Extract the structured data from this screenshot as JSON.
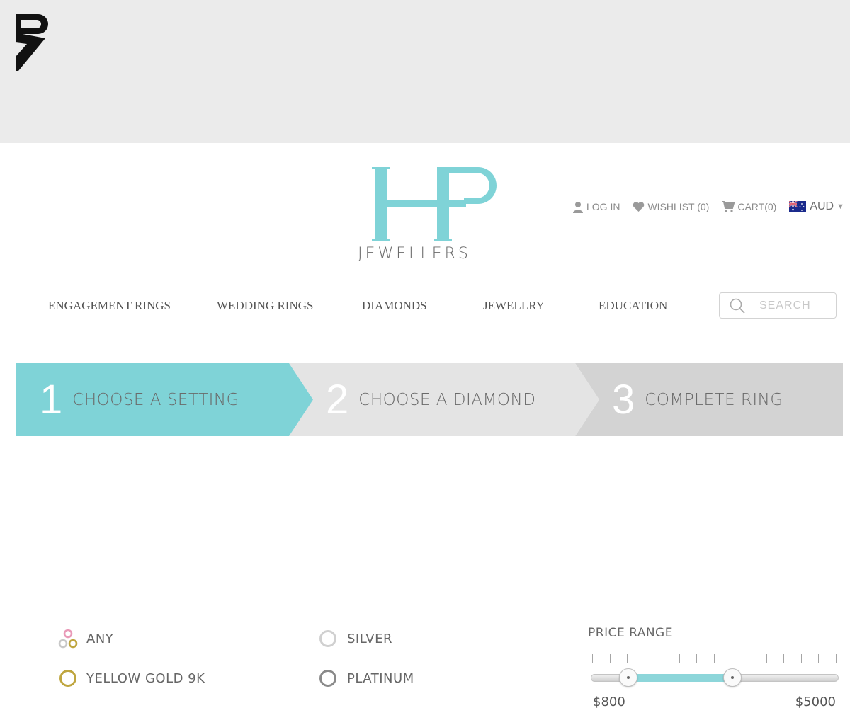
{
  "header": {
    "logo_word": "JEWELLERS",
    "user_links": [
      {
        "label": "LOG IN",
        "icon": "user-icon"
      },
      {
        "label": "WISHLIST (0)",
        "icon": "heart-icon"
      },
      {
        "label": "CART(0)",
        "icon": "cart-icon"
      }
    ],
    "currency": "AUD"
  },
  "nav": {
    "items": [
      "ENGAGEMENT RINGS",
      "WEDDING RINGS",
      "DIAMONDS",
      "JEWELLRY",
      "EDUCATION"
    ],
    "search_placeholder": "SEARCH"
  },
  "steps": [
    {
      "number": "1",
      "label": "CHOOSE A SETTING",
      "active": true
    },
    {
      "number": "2",
      "label": "CHOOSE A DIAMOND",
      "active": false
    },
    {
      "number": "3",
      "label": "COMPLETE RING",
      "active": false
    }
  ],
  "metals": [
    {
      "label": "ANY",
      "icon": "multi-metal-icon"
    },
    {
      "label": "SILVER",
      "icon": "silver-ring-icon",
      "color": "#d0d0d0"
    },
    {
      "label": "YELLOW GOLD 9K",
      "icon": "yellow-gold-ring-icon",
      "color": "#bfa640"
    },
    {
      "label": "PLATINUM",
      "icon": "platinum-ring-icon",
      "color": "#8a8a8a"
    }
  ],
  "price_range": {
    "title": "PRICE RANGE",
    "min_label": "$800",
    "max_label": "$5000",
    "selected_low": 0.15,
    "selected_high": 0.57
  },
  "colors": {
    "accent": "#7fd3d7",
    "step_inactive": "#e4e4e4",
    "step_last": "#d3d3d3",
    "band": "#ebebeb"
  }
}
